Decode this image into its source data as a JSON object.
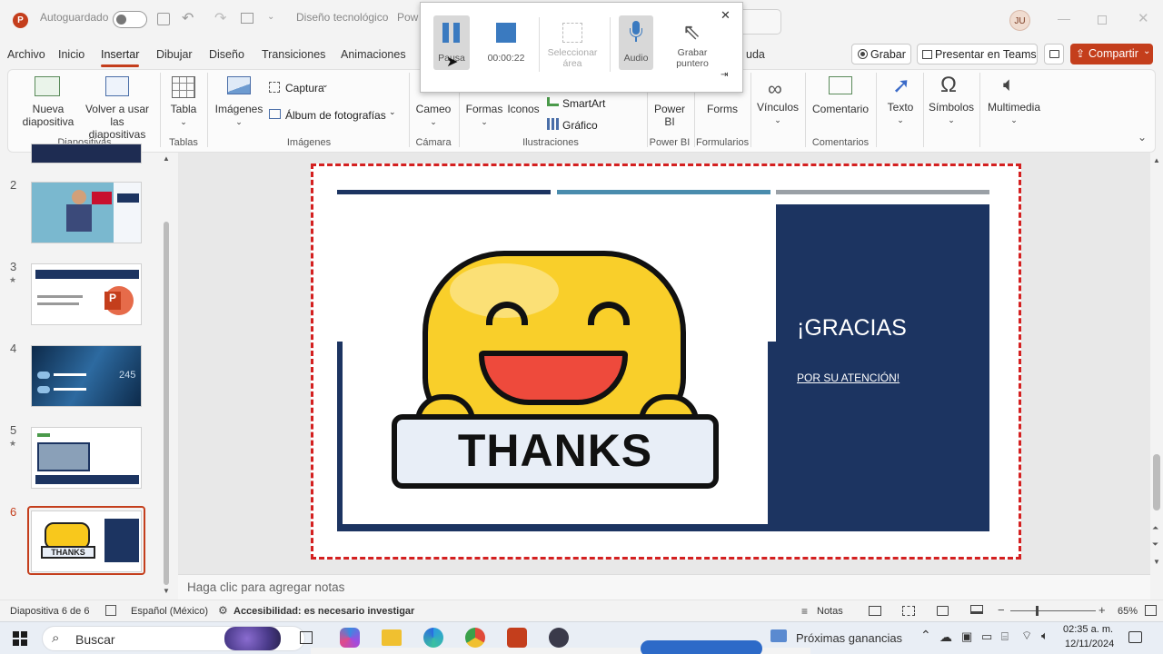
{
  "titlebar": {
    "autosave_label": "Autoguardado",
    "doc_title": "Diseño tecnológico",
    "doc_title_suffix": "Pow",
    "user_initials": "JU"
  },
  "menu": {
    "tabs": [
      "Archivo",
      "Inicio",
      "Insertar",
      "Dibujar",
      "Diseño",
      "Transiciones",
      "Animaciones",
      "uda"
    ],
    "active_tab": "Insertar",
    "record_label": "Grabar",
    "teams_label": "Presentar en Teams",
    "share_label": "Compartir"
  },
  "ribbon": {
    "new_slide": "Nueva diapositiva",
    "new_slide_l1": "Nueva",
    "new_slide_l2": "diapositiva",
    "reuse_l1": "Volver a usar",
    "reuse_l2": "las diapositivas",
    "group_slides": "Diapositivas",
    "table": "Tabla",
    "group_tables": "Tablas",
    "images": "Imágenes",
    "screenshot": "Captura",
    "album": "Álbum de fotografías",
    "group_images": "Imágenes",
    "cameo": "Cameo",
    "group_camera": "Cámara",
    "shapes": "Formas",
    "icons": "Iconos",
    "smartart": "SmartArt",
    "chart": "Gráfico",
    "group_illustrations": "Ilustraciones",
    "powerbi_l1": "Power",
    "powerbi_l2": "BI",
    "group_powerbi": "Power BI",
    "forms": "Forms",
    "group_forms": "Formularios",
    "links": "Vínculos",
    "comment": "Comentario",
    "group_comments": "Comentarios",
    "text": "Texto",
    "symbols": "Símbolos",
    "multimedia": "Multimedia"
  },
  "recorder": {
    "pause": "Pausa",
    "timer": "00:00:22",
    "select_area_l1": "Seleccionar",
    "select_area_l2": "área",
    "audio": "Audio",
    "pointer_l1": "Grabar",
    "pointer_l2": "puntero"
  },
  "thumbnails": {
    "numbers": [
      "2",
      "3",
      "4",
      "5",
      "6"
    ],
    "selected": "6"
  },
  "slide": {
    "heading": "¡GRACIAS",
    "subtitle": "POR SU ATENCIÓN!",
    "sticker_text": "THANKS",
    "colors": {
      "navy": "#1c3461",
      "teal": "#4a8cad",
      "gray": "#9aa0a6"
    }
  },
  "notes_placeholder": "Haga clic para agregar notas",
  "status": {
    "slide_info": "Diapositiva 6 de 6",
    "language": "Español (México)",
    "accessibility": "Accesibilidad: es necesario investigar",
    "notes": "Notas",
    "zoom": "65%"
  },
  "taskbar": {
    "search_placeholder": "Buscar",
    "news": "Próximas ganancias",
    "time": "02:35 a. m.",
    "date": "12/11/2024"
  }
}
